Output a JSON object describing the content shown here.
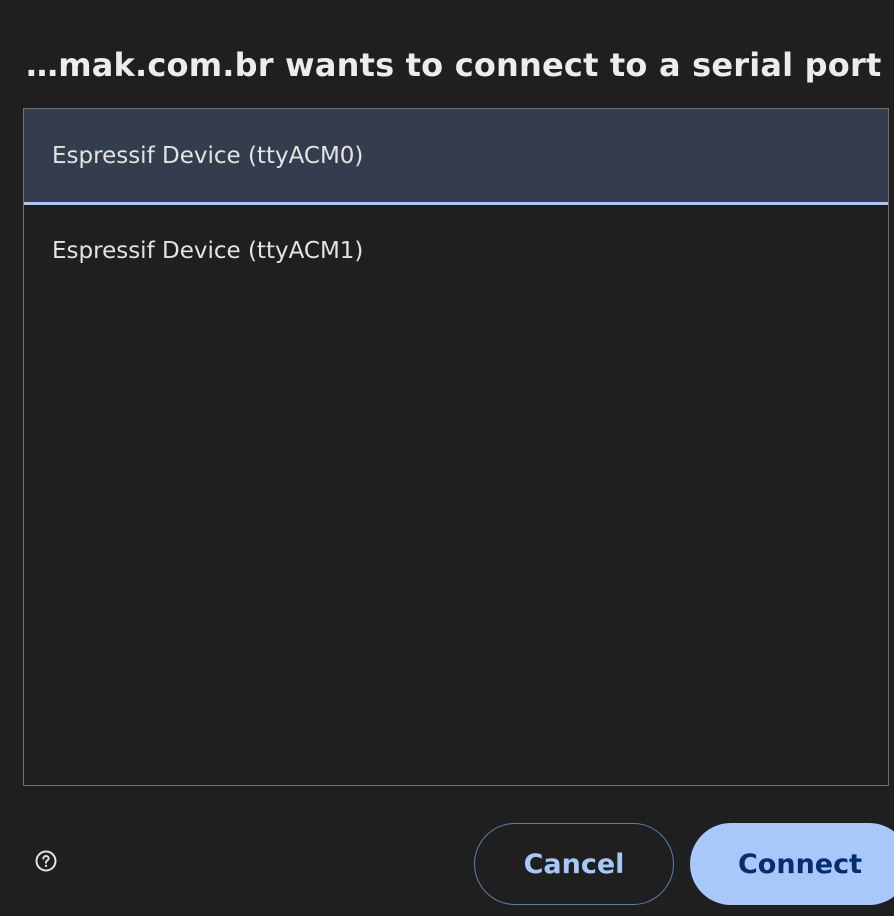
{
  "dialog": {
    "title": "…mak.com.br wants to connect to a serial port",
    "ports": [
      {
        "label": "Espressif Device (ttyACM0)",
        "selected": true
      },
      {
        "label": "Espressif Device (ttyACM1)",
        "selected": false
      }
    ],
    "cancel_label": "Cancel",
    "connect_label": "Connect",
    "help_icon": "help-circle-icon"
  },
  "colors": {
    "background": "#1f1f1f",
    "selected_row": "#333d4d",
    "accent": "#a8c7fa",
    "connect_text": "#062e6f"
  }
}
